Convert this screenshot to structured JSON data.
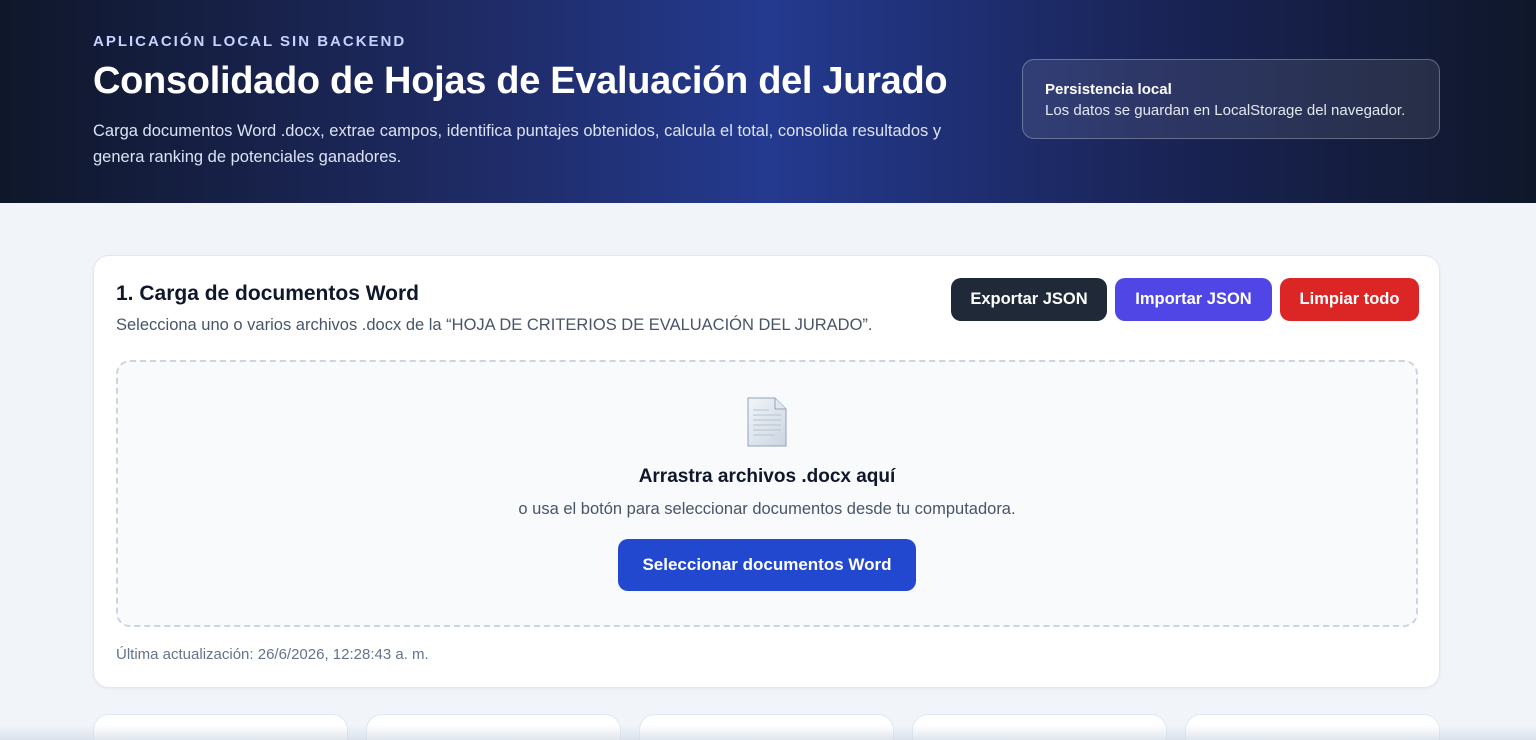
{
  "header": {
    "eyebrow": "APLICACIÓN LOCAL SIN BACKEND",
    "title": "Consolidado de Hojas de Evaluación del Jurado",
    "description": "Carga documentos Word .docx, extrae campos, identifica puntajes obtenidos, calcula el total, consolida resultados y genera ranking de potenciales ganadores.",
    "persistence": {
      "title": "Persistencia local",
      "text": "Los datos se guardan en LocalStorage del navegador."
    }
  },
  "upload": {
    "title": "1. Carga de documentos Word",
    "subtitle": "Selecciona uno o varios archivos .docx de la “HOJA DE CRITERIOS DE EVALUACIÓN DEL JURADO”.",
    "buttons": {
      "export": "Exportar JSON",
      "import": "Importar JSON",
      "clear": "Limpiar todo"
    },
    "dropzone": {
      "icon": "document-icon",
      "title": "Arrastra archivos .docx aquí",
      "subtitle": "o usa el botón para seleccionar documentos desde tu computadora.",
      "button": "Seleccionar documentos Word"
    },
    "last_updated": "Última actualización: 26/6/2026, 12:28:43 a. m."
  },
  "colors": {
    "export_button": "#1f2937",
    "import_button": "#4f46e5",
    "clear_button": "#dc2626",
    "select_button": "#2348d0"
  }
}
